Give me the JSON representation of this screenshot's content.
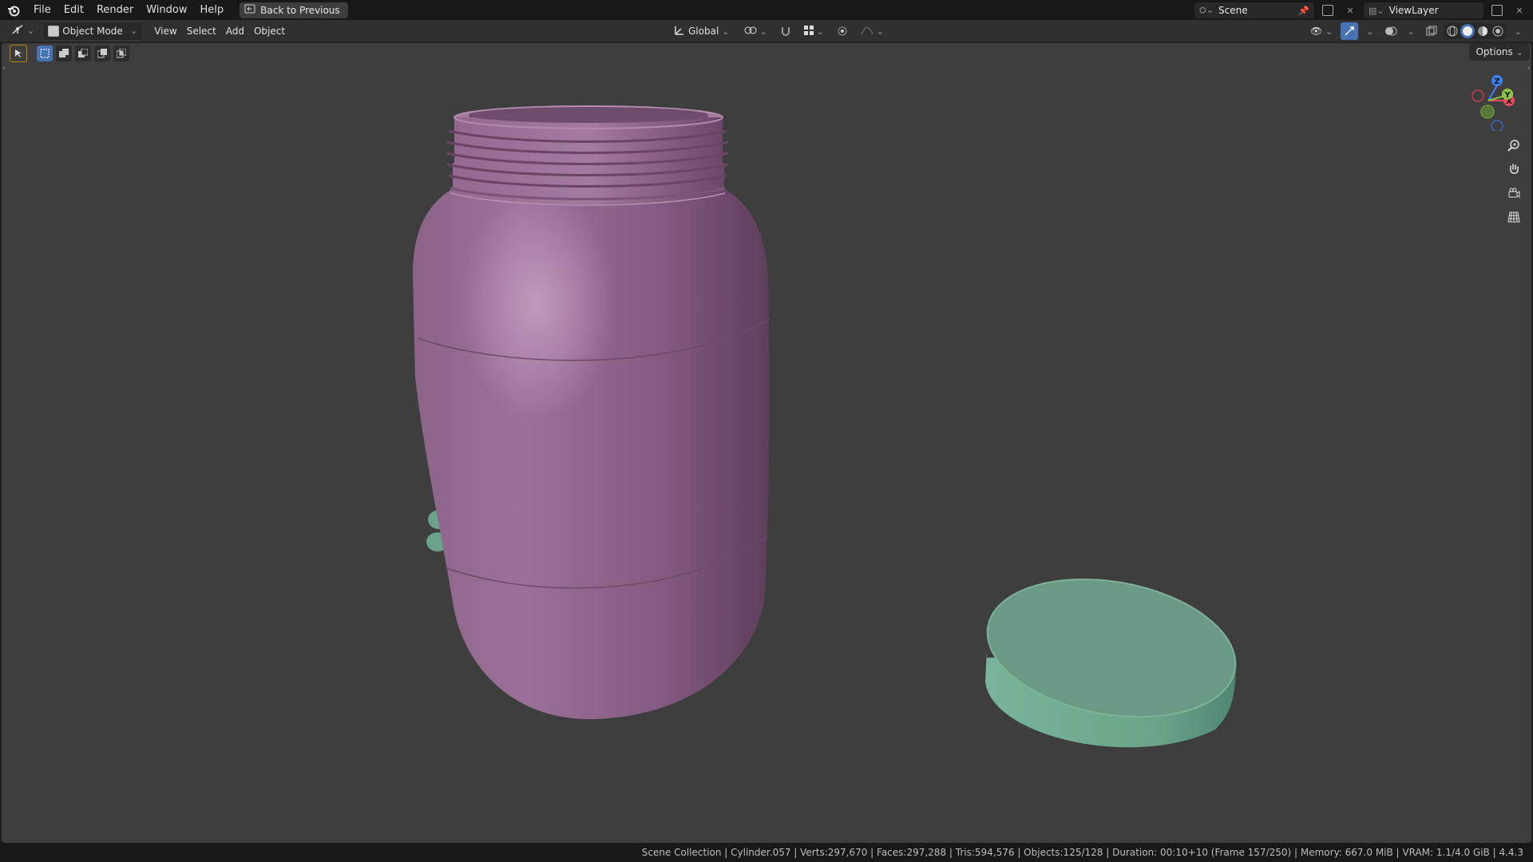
{
  "menu": {
    "items": [
      "File",
      "Edit",
      "Render",
      "Window",
      "Help"
    ],
    "back_button": "Back to Previous"
  },
  "top_right": {
    "scene": "Scene",
    "view_layer": "ViewLayer"
  },
  "viewport_header": {
    "mode": "Object Mode",
    "menus": [
      "View",
      "Select",
      "Add",
      "Object"
    ],
    "orientation": "Global",
    "options": "Options"
  },
  "gizmo": {
    "x": "X",
    "y": "Y",
    "z": "Z",
    "colors": {
      "x": "#e84a5f",
      "y": "#8cc63f",
      "z": "#3b82f6"
    }
  },
  "objects": {
    "jar_color": "#9a6e96",
    "lid_color": "#6aa389"
  },
  "status": {
    "text": "Scene Collection | Cylinder.057 | Verts:297,670 | Faces:297,288 | Tris:594,576 | Objects:125/128 | Duration: 00:10+10 (Frame 157/250) | Memory: 667.0 MiB | VRAM: 1.1/4.0 GiB | 4.4.3"
  },
  "icons": {
    "logo": "blender-logo-icon",
    "editor_type": "3d-viewport-icon",
    "zoom": "zoom-icon",
    "pan": "hand-icon",
    "camera": "camera-icon",
    "ortho": "grid-icon"
  }
}
